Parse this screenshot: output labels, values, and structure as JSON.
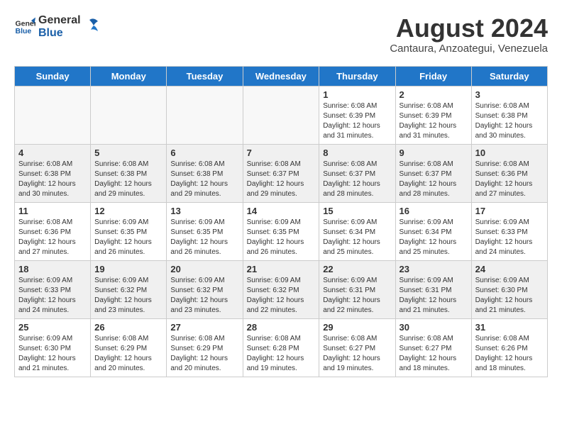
{
  "logo": {
    "line1": "General",
    "line2": "Blue"
  },
  "title": "August 2024",
  "location": "Cantaura, Anzoategui, Venezuela",
  "weekdays": [
    "Sunday",
    "Monday",
    "Tuesday",
    "Wednesday",
    "Thursday",
    "Friday",
    "Saturday"
  ],
  "weeks": [
    [
      {
        "day": "",
        "empty": true
      },
      {
        "day": "",
        "empty": true
      },
      {
        "day": "",
        "empty": true
      },
      {
        "day": "",
        "empty": true
      },
      {
        "day": "1",
        "sunrise": "6:08 AM",
        "sunset": "6:39 PM",
        "daylight": "12 hours and 31 minutes."
      },
      {
        "day": "2",
        "sunrise": "6:08 AM",
        "sunset": "6:39 PM",
        "daylight": "12 hours and 31 minutes."
      },
      {
        "day": "3",
        "sunrise": "6:08 AM",
        "sunset": "6:38 PM",
        "daylight": "12 hours and 30 minutes."
      }
    ],
    [
      {
        "day": "4",
        "sunrise": "6:08 AM",
        "sunset": "6:38 PM",
        "daylight": "12 hours and 30 minutes."
      },
      {
        "day": "5",
        "sunrise": "6:08 AM",
        "sunset": "6:38 PM",
        "daylight": "12 hours and 29 minutes."
      },
      {
        "day": "6",
        "sunrise": "6:08 AM",
        "sunset": "6:38 PM",
        "daylight": "12 hours and 29 minutes."
      },
      {
        "day": "7",
        "sunrise": "6:08 AM",
        "sunset": "6:37 PM",
        "daylight": "12 hours and 29 minutes."
      },
      {
        "day": "8",
        "sunrise": "6:08 AM",
        "sunset": "6:37 PM",
        "daylight": "12 hours and 28 minutes."
      },
      {
        "day": "9",
        "sunrise": "6:08 AM",
        "sunset": "6:37 PM",
        "daylight": "12 hours and 28 minutes."
      },
      {
        "day": "10",
        "sunrise": "6:08 AM",
        "sunset": "6:36 PM",
        "daylight": "12 hours and 27 minutes."
      }
    ],
    [
      {
        "day": "11",
        "sunrise": "6:08 AM",
        "sunset": "6:36 PM",
        "daylight": "12 hours and 27 minutes."
      },
      {
        "day": "12",
        "sunrise": "6:09 AM",
        "sunset": "6:35 PM",
        "daylight": "12 hours and 26 minutes."
      },
      {
        "day": "13",
        "sunrise": "6:09 AM",
        "sunset": "6:35 PM",
        "daylight": "12 hours and 26 minutes."
      },
      {
        "day": "14",
        "sunrise": "6:09 AM",
        "sunset": "6:35 PM",
        "daylight": "12 hours and 26 minutes."
      },
      {
        "day": "15",
        "sunrise": "6:09 AM",
        "sunset": "6:34 PM",
        "daylight": "12 hours and 25 minutes."
      },
      {
        "day": "16",
        "sunrise": "6:09 AM",
        "sunset": "6:34 PM",
        "daylight": "12 hours and 25 minutes."
      },
      {
        "day": "17",
        "sunrise": "6:09 AM",
        "sunset": "6:33 PM",
        "daylight": "12 hours and 24 minutes."
      }
    ],
    [
      {
        "day": "18",
        "sunrise": "6:09 AM",
        "sunset": "6:33 PM",
        "daylight": "12 hours and 24 minutes."
      },
      {
        "day": "19",
        "sunrise": "6:09 AM",
        "sunset": "6:32 PM",
        "daylight": "12 hours and 23 minutes."
      },
      {
        "day": "20",
        "sunrise": "6:09 AM",
        "sunset": "6:32 PM",
        "daylight": "12 hours and 23 minutes."
      },
      {
        "day": "21",
        "sunrise": "6:09 AM",
        "sunset": "6:32 PM",
        "daylight": "12 hours and 22 minutes."
      },
      {
        "day": "22",
        "sunrise": "6:09 AM",
        "sunset": "6:31 PM",
        "daylight": "12 hours and 22 minutes."
      },
      {
        "day": "23",
        "sunrise": "6:09 AM",
        "sunset": "6:31 PM",
        "daylight": "12 hours and 21 minutes."
      },
      {
        "day": "24",
        "sunrise": "6:09 AM",
        "sunset": "6:30 PM",
        "daylight": "12 hours and 21 minutes."
      }
    ],
    [
      {
        "day": "25",
        "sunrise": "6:09 AM",
        "sunset": "6:30 PM",
        "daylight": "12 hours and 21 minutes."
      },
      {
        "day": "26",
        "sunrise": "6:08 AM",
        "sunset": "6:29 PM",
        "daylight": "12 hours and 20 minutes."
      },
      {
        "day": "27",
        "sunrise": "6:08 AM",
        "sunset": "6:29 PM",
        "daylight": "12 hours and 20 minutes."
      },
      {
        "day": "28",
        "sunrise": "6:08 AM",
        "sunset": "6:28 PM",
        "daylight": "12 hours and 19 minutes."
      },
      {
        "day": "29",
        "sunrise": "6:08 AM",
        "sunset": "6:27 PM",
        "daylight": "12 hours and 19 minutes."
      },
      {
        "day": "30",
        "sunrise": "6:08 AM",
        "sunset": "6:27 PM",
        "daylight": "12 hours and 18 minutes."
      },
      {
        "day": "31",
        "sunrise": "6:08 AM",
        "sunset": "6:26 PM",
        "daylight": "12 hours and 18 minutes."
      }
    ]
  ],
  "labels": {
    "sunrise": "Sunrise:",
    "sunset": "Sunset:",
    "daylight": "Daylight:"
  }
}
